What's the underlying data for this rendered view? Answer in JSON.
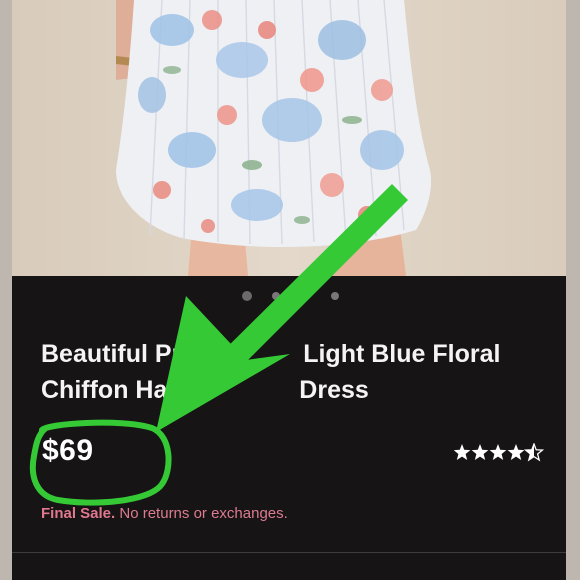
{
  "product": {
    "title": "Beautiful Pr... Light Blue Floral Chiffon Ha... Dress",
    "title_line1_a": "Beautiful Pr",
    "title_line1_b": "Light Blue Floral",
    "title_line2_a": "Chiffon Ha",
    "title_line2_b": "Dress",
    "price": "$69",
    "rating_stars": 4.5,
    "sale_tag": "Final Sale.",
    "sale_text": "No returns or exchanges."
  },
  "carousel": {
    "dot_count": 4,
    "active_index": 0
  },
  "colors": {
    "background": "#161415",
    "annotation_green": "#35c935",
    "sale_pink": "#e2788e",
    "text": "#f5f3f4"
  },
  "icons": {
    "rating": "star-icon",
    "annotation": "arrow-annotation"
  }
}
